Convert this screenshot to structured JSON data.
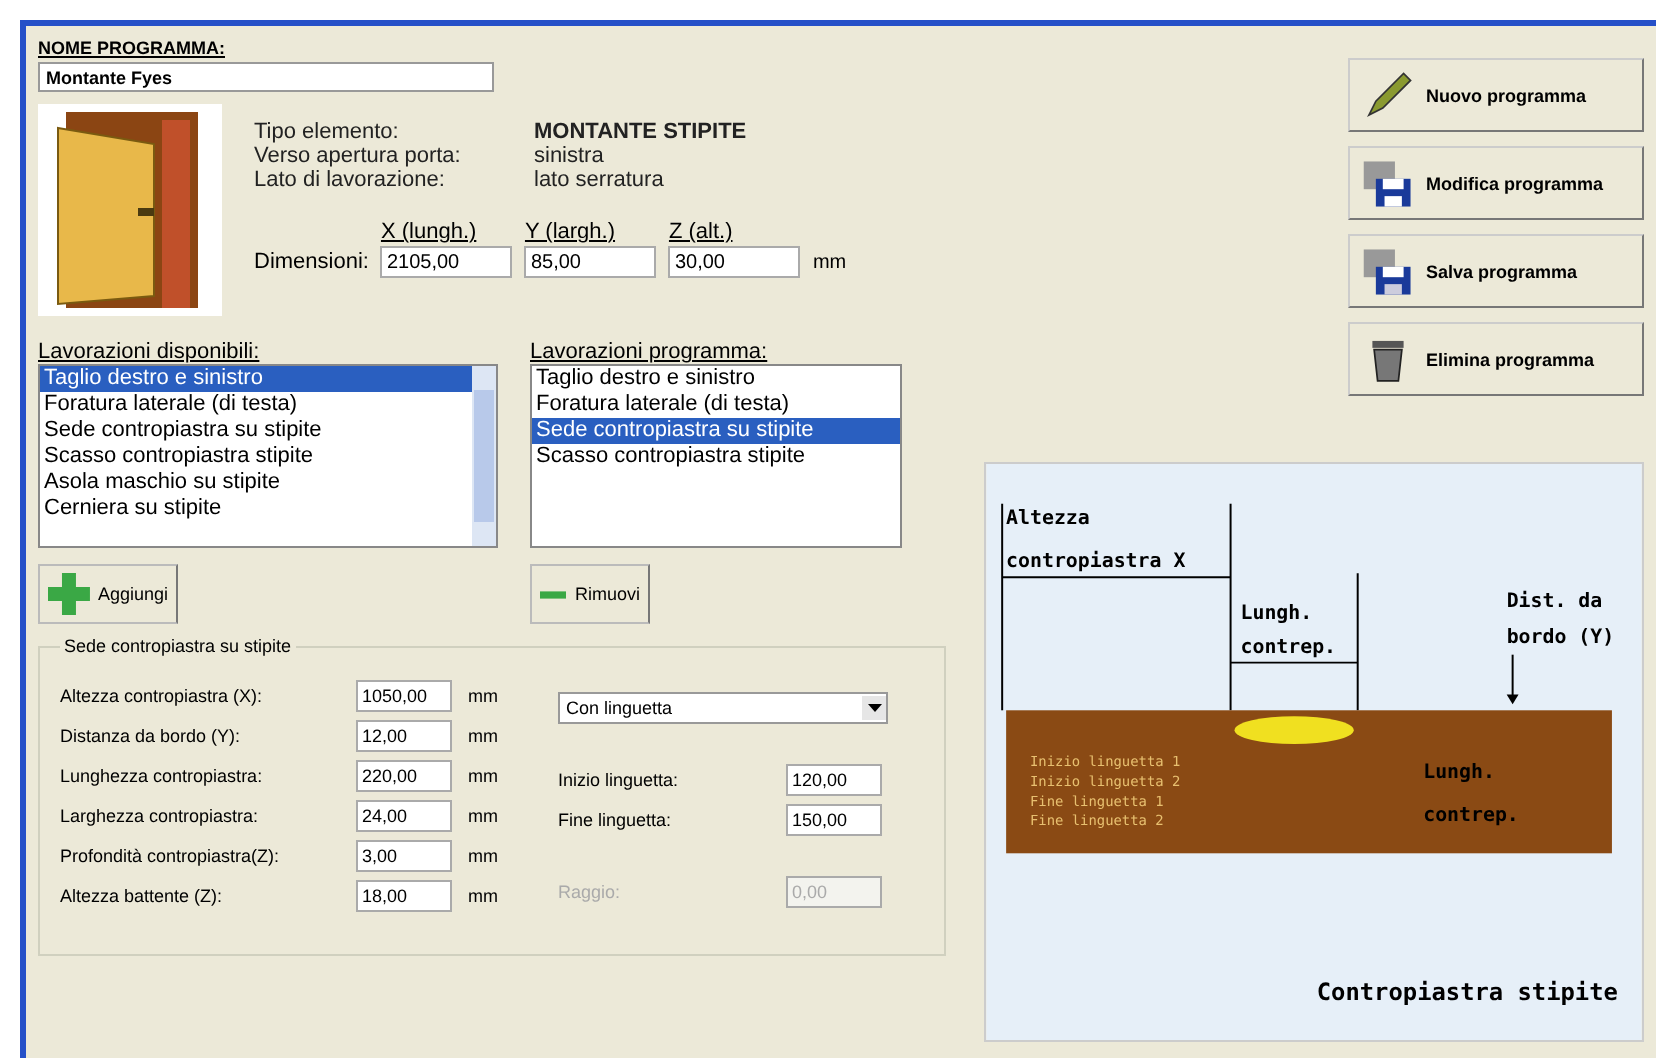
{
  "program_name": {
    "label": "NOME PROGRAMMA:",
    "value": "Montante Fyes"
  },
  "info": [
    {
      "label": "Tipo elemento:",
      "value": "MONTANTE STIPITE"
    },
    {
      "label": "Verso apertura porta:",
      "value": "sinistra"
    },
    {
      "label": "Lato di lavorazione:",
      "value": "lato serratura"
    }
  ],
  "dimensions": {
    "label": "Dimensioni:",
    "unit": "mm",
    "fields": [
      {
        "header": "X (lungh.)",
        "value": "2105,00"
      },
      {
        "header": "Y (largh.)",
        "value": "85,00"
      },
      {
        "header": "Z (alt.)",
        "value": "30,00"
      }
    ]
  },
  "actions": [
    {
      "kind": "pencil",
      "label": "Nuovo programma"
    },
    {
      "kind": "floppy-edit",
      "label": "Modifica programma"
    },
    {
      "kind": "floppy-save",
      "label": "Salva programma"
    },
    {
      "kind": "trash",
      "label": "Elimina programma"
    }
  ],
  "available": {
    "title": "Lavorazioni disponibili:",
    "items": [
      {
        "label": "Taglio destro e sinistro",
        "selected": true
      },
      {
        "label": "Foratura laterale (di testa)",
        "selected": false
      },
      {
        "label": "Sede contropiastra su stipite",
        "selected": false
      },
      {
        "label": "Scasso contropiastra stipite",
        "selected": false
      },
      {
        "label": "Asola maschio su stipite",
        "selected": false
      },
      {
        "label": "Cerniera su stipite",
        "selected": false
      }
    ]
  },
  "programmed": {
    "title": "Lavorazioni programma:",
    "items": [
      {
        "label": "Taglio destro e sinistro",
        "selected": false
      },
      {
        "label": "Foratura laterale (di testa)",
        "selected": false
      },
      {
        "label": "Sede contropiastra su stipite",
        "selected": true
      },
      {
        "label": "Scasso contropiastra stipite",
        "selected": false
      }
    ]
  },
  "add_button": "Aggiungi",
  "remove_button": "Rimuovi",
  "params": {
    "title": "Sede contropiastra su stipite",
    "rows": [
      {
        "label": "Altezza contropiastra (X):",
        "value": "1050,00",
        "unit": "mm"
      },
      {
        "label": "Distanza da bordo (Y):",
        "value": "12,00",
        "unit": "mm"
      },
      {
        "label": "Lunghezza contropiastra:",
        "value": "220,00",
        "unit": "mm"
      },
      {
        "label": "Larghezza contropiastra:",
        "value": "24,00",
        "unit": "mm"
      },
      {
        "label": "Profondità contropiastra(Z):",
        "value": "3,00",
        "unit": "mm"
      },
      {
        "label": "Altezza battente (Z):",
        "value": "18,00",
        "unit": "mm"
      }
    ],
    "dropdown": "Con linguetta",
    "side_fields": [
      {
        "label": "Inizio linguetta:",
        "value": "120,00",
        "disabled": false
      },
      {
        "label": "Fine linguetta:",
        "value": "150,00",
        "disabled": false
      },
      {
        "label": "Raggio:",
        "value": "0,00",
        "disabled": true
      }
    ]
  },
  "diagram": {
    "height_label": "Altezza",
    "height_label_2": "contropiastra X",
    "length_label": "Lungh.",
    "length_label_2": "contrep.",
    "edge_label": "Dist. da",
    "edge_label_2": "bordo (Y)",
    "tab_labels": [
      "Inizio linguetta 1",
      "Inizio linguetta 2",
      "Fine linguetta 1",
      "Fine linguetta 2"
    ],
    "inner_label": "Lungh.",
    "inner_label_2": "contrep.",
    "caption": "Contropiastra stipite"
  }
}
